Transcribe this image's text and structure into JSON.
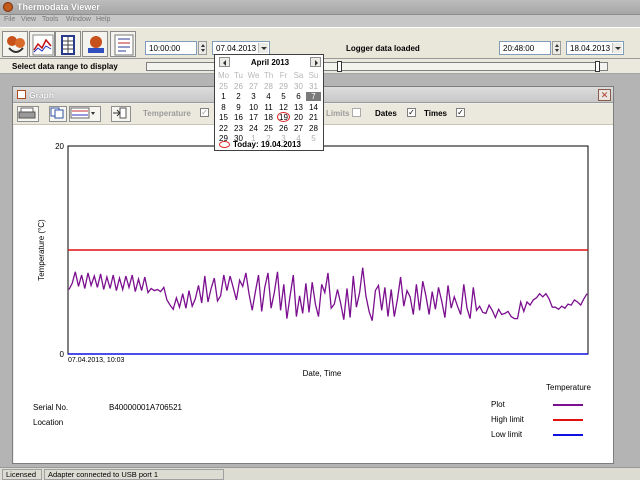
{
  "app": {
    "title": "Thermodata Viewer"
  },
  "menu": [
    "File",
    "View",
    "Tools",
    "Window",
    "Help"
  ],
  "toolbar": {
    "start_time": "10:00:00",
    "start_date": "07.04.2013",
    "status": "Logger data loaded",
    "end_time": "20:48:00",
    "end_date": "18.04.2013"
  },
  "range": {
    "label": "Select data range to display"
  },
  "calendar": {
    "month": "April 2013",
    "weekdays": [
      "Mo",
      "Tu",
      "We",
      "Th",
      "Fr",
      "Sa",
      "Su"
    ],
    "weeks": [
      [
        [
          "25",
          "o"
        ],
        [
          "26",
          "o"
        ],
        [
          "27",
          "o"
        ],
        [
          "28",
          "o"
        ],
        [
          "29",
          "o"
        ],
        [
          "30",
          "o"
        ],
        [
          "31",
          "o"
        ]
      ],
      [
        [
          "1",
          ""
        ],
        [
          "2",
          ""
        ],
        [
          "3",
          ""
        ],
        [
          "4",
          ""
        ],
        [
          "5",
          ""
        ],
        [
          "6",
          ""
        ],
        [
          "7",
          "s"
        ]
      ],
      [
        [
          "8",
          ""
        ],
        [
          "9",
          ""
        ],
        [
          "10",
          ""
        ],
        [
          "11",
          ""
        ],
        [
          "12",
          ""
        ],
        [
          "13",
          ""
        ],
        [
          "14",
          ""
        ]
      ],
      [
        [
          "15",
          ""
        ],
        [
          "16",
          ""
        ],
        [
          "17",
          ""
        ],
        [
          "18",
          ""
        ],
        [
          "19",
          "t"
        ],
        [
          "20",
          ""
        ],
        [
          "21",
          ""
        ]
      ],
      [
        [
          "22",
          ""
        ],
        [
          "23",
          ""
        ],
        [
          "24",
          ""
        ],
        [
          "25",
          ""
        ],
        [
          "26",
          ""
        ],
        [
          "27",
          ""
        ],
        [
          "28",
          ""
        ]
      ],
      [
        [
          "29",
          ""
        ],
        [
          "30",
          ""
        ],
        [
          "1",
          "o"
        ],
        [
          "2",
          "o"
        ],
        [
          "3",
          "o"
        ],
        [
          "4",
          "o"
        ],
        [
          "5",
          "o"
        ]
      ]
    ],
    "today_label": "Today: 19.04.2013"
  },
  "graph": {
    "title": "Graph",
    "toolbar": {
      "temperature_label": "Temperature",
      "limits_label": "Limits",
      "dates_label": "Dates",
      "times_label": "Times",
      "dates_checked": "✓",
      "times_checked": "✓",
      "temperature_checked": "✓"
    },
    "serial_label": "Serial No.",
    "serial_value": "B40000001A706521",
    "location_label": "Location",
    "legend": {
      "title": "Temperature",
      "items": [
        {
          "label": "Plot",
          "color": "#7b0f8f"
        },
        {
          "label": "High limit",
          "color": "#e01010"
        },
        {
          "label": "Low limit",
          "color": "#1010e0"
        }
      ]
    }
  },
  "chart_data": {
    "type": "line",
    "ylabel": "Temperature (°C)",
    "xlabel": "Date, Time",
    "x_start_label": "07.04.2013, 10:03",
    "ylim": [
      0,
      20
    ],
    "y_ticks": [
      "20",
      "0"
    ],
    "high_limit": 10,
    "low_limit": 0,
    "series": [
      {
        "name": "Plot",
        "color": "#7b0f8f",
        "values": [
          6.2,
          6.8,
          7.9,
          6.5,
          7.6,
          6.3,
          7.8,
          6.6,
          7.5,
          6.4,
          7.7,
          6.2,
          7.4,
          6.3,
          7.6,
          6.1,
          7.3,
          6.2,
          7.5,
          6.4,
          7.6,
          6.0,
          7.2,
          6.1,
          7.4,
          5.9,
          6.3,
          6.1,
          6.2,
          6.0,
          6.4,
          5.2,
          4.7,
          4.3,
          5.4,
          4.5,
          5.8,
          4.4,
          6.1,
          4.6,
          5.3,
          6.6,
          4.9,
          7.5,
          5.0,
          6.3,
          7.3,
          5.1,
          5.6,
          7.6,
          6.1,
          7.5,
          6.4,
          5.2,
          7.1,
          6.5,
          7.8,
          5.8,
          4.2,
          6.0,
          7.6,
          4.1,
          6.4,
          7.8,
          4.4,
          5.9,
          7.9,
          4.2,
          6.7,
          3.4,
          5.6,
          7.6,
          3.6,
          5.6,
          3.9,
          6.8,
          4.0,
          6.9,
          4.8,
          3.6,
          6.7,
          5.9,
          7.8,
          4.4,
          4.8,
          6.2,
          4.9,
          3.3,
          6.3,
          3.5,
          7.5,
          4.5,
          5.9,
          8.3,
          5.6,
          4.1,
          3.2,
          6.1,
          6.6,
          4.2,
          6.4,
          3.6,
          6.2,
          3.6,
          5.3,
          7.4,
          4.6,
          6.1,
          5.5,
          3.8,
          6.7,
          4.2,
          7.0,
          5.6,
          3.8,
          6.0,
          4.3,
          6.4,
          5.1,
          3.5,
          6.6,
          4.4,
          5.5,
          4.6,
          3.8,
          6.7,
          4.4,
          3.4,
          6.4,
          4.2,
          4.6,
          4.0,
          3.9,
          4.7,
          4.2,
          3.5,
          4.3,
          3.8,
          3.9,
          4.1,
          3.6,
          3.4,
          3.4,
          5.0,
          4.1,
          5.0,
          4.7,
          5.2,
          5.4,
          5.8,
          5.5,
          5.8,
          5.3,
          4.5,
          4.5,
          4.3,
          4.6,
          4.4,
          4.8,
          4.7,
          5.2,
          5.0,
          4.7,
          5.3,
          5.8
        ]
      }
    ]
  }
}
